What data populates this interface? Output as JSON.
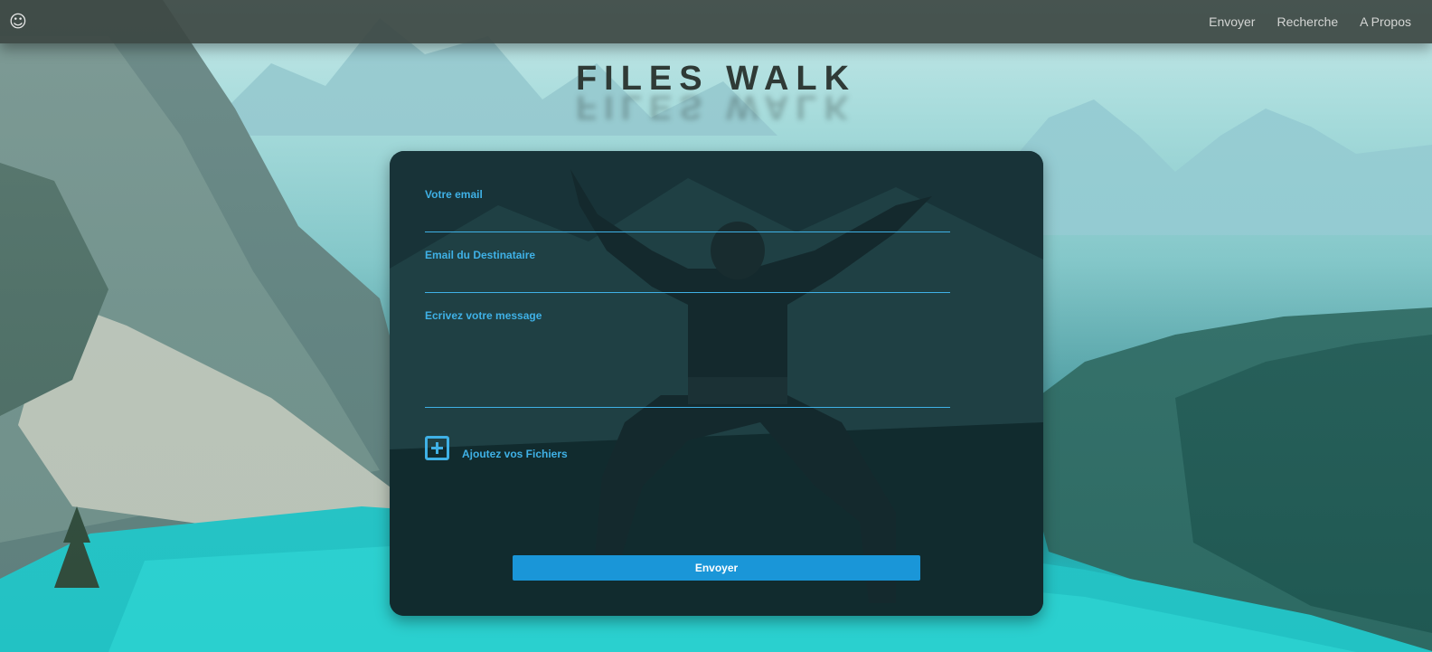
{
  "navbar": {
    "logo_icon": "smiley-face-icon",
    "logo_glyph": "☺",
    "links": [
      "Envoyer",
      "Recherche",
      "A Propos"
    ]
  },
  "title": "FILES WALK",
  "form": {
    "email_label": "Votre email",
    "email_value": "",
    "recipient_label": "Email du Destinataire",
    "recipient_value": "",
    "message_label": "Ecrivez votre message",
    "message_value": "",
    "add_files_icon": "plus-square-icon",
    "add_files_label": "Ajoutez vos Fichiers",
    "submit_label": "Envoyer"
  },
  "colors": {
    "accent": "#3fb1e6",
    "button": "#1a96d8",
    "navbar": "#3c4642",
    "title": "#2f3a36"
  }
}
